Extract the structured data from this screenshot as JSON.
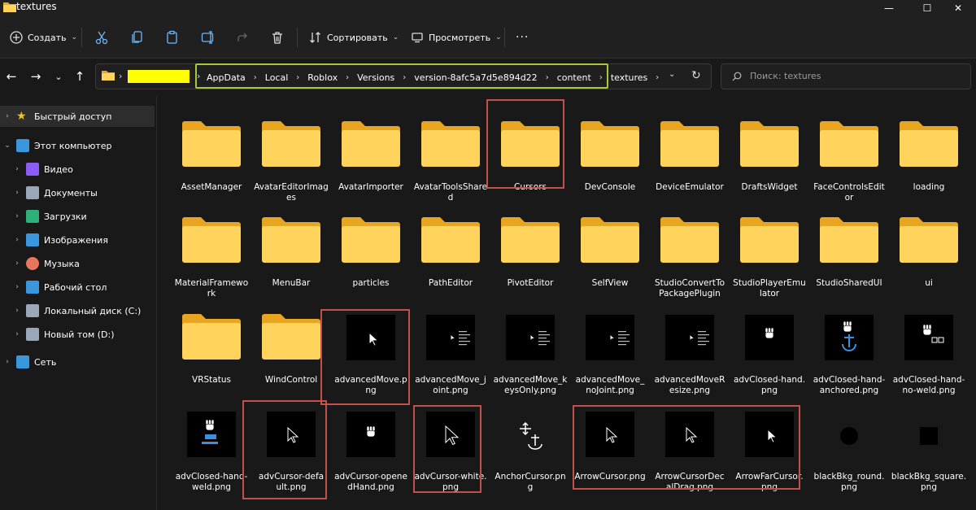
{
  "window": {
    "title": "textures",
    "controls": {
      "minimize": "—",
      "maximize": "☐",
      "close": "✕"
    }
  },
  "toolbar": {
    "new_label": "Создать",
    "sort_label": "Сортировать",
    "view_label": "Просмотреть",
    "more_label": "···",
    "icons": [
      "cut-icon",
      "copy-icon",
      "paste-icon",
      "rename-icon",
      "share-icon",
      "delete-icon"
    ]
  },
  "address": {
    "path": [
      "AppData",
      "Local",
      "Roblox",
      "Versions",
      "version-8afc5a7d5e894d22",
      "content",
      "textures"
    ],
    "search_placeholder": "Поиск: textures",
    "redaction_color": "#ffff00",
    "highlight_color": "#a4c93c"
  },
  "sidebar": {
    "items": [
      {
        "label": "Быстрый доступ",
        "icon": "star-icon",
        "color": "#f0c419",
        "selected": true
      },
      {
        "label": "Этот компьютер",
        "icon": "computer-icon",
        "color": "#3a96dd",
        "selected": false
      },
      {
        "label": "Видео",
        "icon": "video-icon",
        "color": "#8b5cf6",
        "selected": false
      },
      {
        "label": "Документы",
        "icon": "documents-icon",
        "color": "#9aa7b8",
        "selected": false
      },
      {
        "label": "Загрузки",
        "icon": "downloads-icon",
        "color": "#2fb07a",
        "selected": false
      },
      {
        "label": "Изображения",
        "icon": "pictures-icon",
        "color": "#3a96dd",
        "selected": false
      },
      {
        "label": "Музыка",
        "icon": "music-icon",
        "color": "#e8765a",
        "selected": false
      },
      {
        "label": "Рабочий стол",
        "icon": "desktop-icon",
        "color": "#3a96dd",
        "selected": false
      },
      {
        "label": "Локальный диск (C:)",
        "icon": "drive-icon",
        "color": "#9aa7b8",
        "selected": false
      },
      {
        "label": "Новый том (D:)",
        "icon": "drive-icon",
        "color": "#9aa7b8",
        "selected": false
      },
      {
        "label": "Сеть",
        "icon": "network-icon",
        "color": "#3a96dd",
        "selected": false
      }
    ]
  },
  "files": [
    {
      "name": "AssetManager",
      "type": "folder"
    },
    {
      "name": "AvatarEditorImages",
      "type": "folder"
    },
    {
      "name": "AvatarImporter",
      "type": "folder"
    },
    {
      "name": "AvatarToolsShared",
      "type": "folder"
    },
    {
      "name": "Cursors",
      "type": "folder",
      "highlighted": true
    },
    {
      "name": "DevConsole",
      "type": "folder"
    },
    {
      "name": "DeviceEmulator",
      "type": "folder"
    },
    {
      "name": "DraftsWidget",
      "type": "folder"
    },
    {
      "name": "FaceControlsEditor",
      "type": "folder"
    },
    {
      "name": "loading",
      "type": "folder"
    },
    {
      "name": "MaterialFramework",
      "type": "folder"
    },
    {
      "name": "MenuBar",
      "type": "folder"
    },
    {
      "name": "particles",
      "type": "folder"
    },
    {
      "name": "PathEditor",
      "type": "folder"
    },
    {
      "name": "PivotEditor",
      "type": "folder"
    },
    {
      "name": "SelfView",
      "type": "folder"
    },
    {
      "name": "StudioConvertToPackagePlugin",
      "type": "folder"
    },
    {
      "name": "StudioPlayerEmulator",
      "type": "folder"
    },
    {
      "name": "StudioSharedUI",
      "type": "folder"
    },
    {
      "name": "ui",
      "type": "folder"
    },
    {
      "name": "VRStatus",
      "type": "folder"
    },
    {
      "name": "WindControl",
      "type": "folder"
    },
    {
      "name": "advancedMove.png",
      "type": "png",
      "glyph": "arrow-cursor-white",
      "highlighted": true
    },
    {
      "name": "advancedMove_joint.png",
      "type": "png",
      "glyph": "arrow-cursor-list"
    },
    {
      "name": "advancedMove_keysOnly.png",
      "type": "png",
      "glyph": "arrow-cursor-list"
    },
    {
      "name": "advancedMove_noJoint.png",
      "type": "png",
      "glyph": "arrow-cursor-list"
    },
    {
      "name": "advancedMoveResize.png",
      "type": "png",
      "glyph": "arrow-cursor-list"
    },
    {
      "name": "advClosed-hand.png",
      "type": "png",
      "glyph": "closed-hand"
    },
    {
      "name": "advClosed-hand-anchored.png",
      "type": "png",
      "glyph": "closed-hand-anchor"
    },
    {
      "name": "advClosed-hand-no-weld.png",
      "type": "png",
      "glyph": "closed-hand-noweld"
    },
    {
      "name": "advClosed-hand-weld.png",
      "type": "png",
      "glyph": "closed-hand-weld"
    },
    {
      "name": "advCursor-default.png",
      "type": "png",
      "glyph": "arrow-cursor-outline",
      "highlighted": true
    },
    {
      "name": "advCursor-openedHand.png",
      "type": "png",
      "glyph": "open-hand"
    },
    {
      "name": "advCursor-white.png",
      "type": "png",
      "glyph": "arrow-cursor-outline-big",
      "highlighted": true
    },
    {
      "name": "AnchorCursor.png",
      "type": "png",
      "glyph": "anchor-cursor",
      "transparent": true
    },
    {
      "name": "ArrowCursor.png",
      "type": "png",
      "glyph": "arrow-cursor-outline",
      "highlighted": true
    },
    {
      "name": "ArrowCursorDecalDrag.png",
      "type": "png",
      "glyph": "arrow-cursor-outline",
      "highlighted": true
    },
    {
      "name": "ArrowFarCursor.png",
      "type": "png",
      "glyph": "arrow-cursor-white",
      "highlighted": true
    },
    {
      "name": "blackBkg_round.png",
      "type": "png",
      "glyph": "black-circle",
      "transparent": true
    },
    {
      "name": "blackBkg_square.png",
      "type": "png",
      "glyph": "black-square",
      "transparent": true
    }
  ],
  "display_names": [
    [
      "AssetManager"
    ],
    [
      "AvatarEditorImag",
      "es"
    ],
    [
      "AvatarImporter"
    ],
    [
      "AvatarToolsShare",
      "d"
    ],
    [
      "Cursors"
    ],
    [
      "DevConsole"
    ],
    [
      "DeviceEmulator"
    ],
    [
      "DraftsWidget"
    ],
    [
      "FaceControlsEdit",
      "or"
    ],
    [
      "loading"
    ],
    [
      "MaterialFramewo",
      "rk"
    ],
    [
      "MenuBar"
    ],
    [
      "particles"
    ],
    [
      "PathEditor"
    ],
    [
      "PivotEditor"
    ],
    [
      "SelfView"
    ],
    [
      "StudioConvertTo",
      "PackagePlugin"
    ],
    [
      "StudioPlayerEmu",
      "lator"
    ],
    [
      "StudioSharedUI"
    ],
    [
      "ui"
    ],
    [
      "VRStatus"
    ],
    [
      "WindControl"
    ],
    [
      "advancedMove.p",
      "ng"
    ],
    [
      "advancedMove_j",
      "oint.png"
    ],
    [
      "advancedMove_k",
      "eysOnly.png"
    ],
    [
      "advancedMove_",
      "noJoint.png"
    ],
    [
      "advancedMoveR",
      "esize.png"
    ],
    [
      "advClosed-hand.",
      "png"
    ],
    [
      "advClosed-hand-",
      "anchored.png"
    ],
    [
      "advClosed-hand-",
      "no-weld.png"
    ],
    [
      "advClosed-hand-",
      "weld.png"
    ],
    [
      "advCursor-defa",
      "ult.png"
    ],
    [
      "advCursor-opene",
      "dHand.png"
    ],
    [
      "advCursor-white.",
      "png"
    ],
    [
      "AnchorCursor.pn",
      "g"
    ],
    [
      "ArrowCursor.png"
    ],
    [
      "ArrowCursorDec",
      "alDrag.png"
    ],
    [
      "ArrowFarCursor.",
      "png"
    ],
    [
      "blackBkg_round.",
      "png"
    ],
    [
      "blackBkg_square.",
      "png"
    ]
  ],
  "theme": {
    "folder_back": "#e8a520",
    "folder_front": "#ffd35c",
    "highlight_red": "#c2504b"
  }
}
